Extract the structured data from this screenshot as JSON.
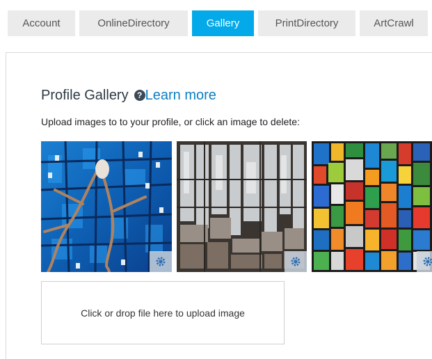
{
  "tabs": [
    {
      "label": "Account"
    },
    {
      "label": "OnlineDirectory"
    },
    {
      "label": "Gallery"
    },
    {
      "label": "PrintDirectory"
    },
    {
      "label": "ArtCrawl"
    }
  ],
  "active_tab": "Gallery",
  "colors": {
    "accent": "#03a9e8",
    "link": "#0b7fc2"
  },
  "gallery": {
    "title": "Profile Gallery",
    "help_icon": "question-circle-icon",
    "learn_more": "Learn more",
    "instructions": "Upload images to to your profile, or click an image to delete:",
    "images": [
      {
        "name": "blue-stained-glass-image",
        "options_icon": "gear-icon"
      },
      {
        "name": "grey-birch-stained-glass-image",
        "options_icon": "gear-icon"
      },
      {
        "name": "colorful-mosaic-stained-glass-image",
        "options_icon": "gear-icon"
      }
    ],
    "upload_text": "Click or drop file here to upload image"
  }
}
